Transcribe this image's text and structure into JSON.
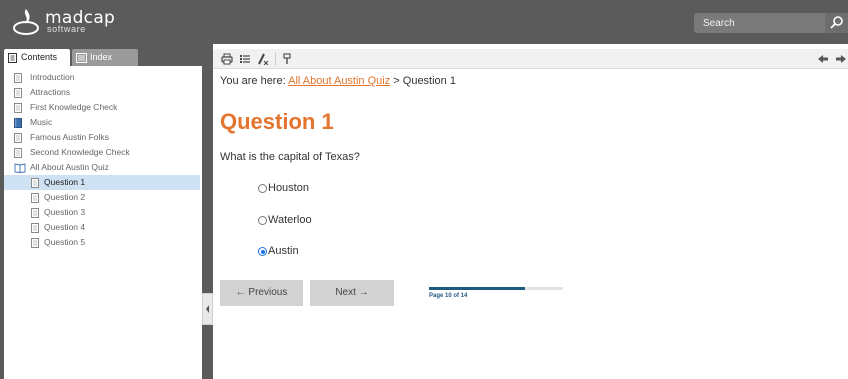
{
  "header": {
    "logo_word": "madcap",
    "logo_sub": "software",
    "search_placeholder": "Search",
    "icons": {
      "logo": "madcap-flame-logo-icon",
      "search": "magnifier-icon"
    }
  },
  "nav": {
    "tabs": [
      {
        "label": "Contents",
        "active": true,
        "icon": "contents-book-icon"
      },
      {
        "label": "Index",
        "active": false,
        "icon": "index-list-icon"
      }
    ],
    "items": [
      {
        "label": "Introduction",
        "level": 0,
        "icon": "page-icon",
        "selected": false
      },
      {
        "label": "Attractions",
        "level": 0,
        "icon": "page-icon",
        "selected": false
      },
      {
        "label": "First Knowledge Check",
        "level": 0,
        "icon": "page-icon",
        "selected": false
      },
      {
        "label": "Music",
        "level": 0,
        "icon": "closed-book-icon",
        "selected": false
      },
      {
        "label": "Famous Austin Folks",
        "level": 0,
        "icon": "page-icon",
        "selected": false
      },
      {
        "label": "Second Knowledge Check",
        "level": 0,
        "icon": "page-icon",
        "selected": false
      },
      {
        "label": "All About Austin Quiz",
        "level": 0,
        "icon": "open-book-icon",
        "selected": false
      },
      {
        "label": "Question 1",
        "level": 1,
        "icon": "page-icon",
        "selected": true
      },
      {
        "label": "Question 2",
        "level": 1,
        "icon": "page-icon",
        "selected": false
      },
      {
        "label": "Question 3",
        "level": 1,
        "icon": "page-icon",
        "selected": false
      },
      {
        "label": "Question 4",
        "level": 1,
        "icon": "page-icon",
        "selected": false
      },
      {
        "label": "Question 5",
        "level": 1,
        "icon": "page-icon",
        "selected": false
      }
    ]
  },
  "toolbar": {
    "buttons": [
      "print-icon",
      "list-icon",
      "clear-highlight-icon",
      "remove-highlight-icon",
      "back-arrow-icon",
      "forward-arrow-icon"
    ]
  },
  "main": {
    "breadcrumb_prefix": "You are here: ",
    "breadcrumb_link": "All About Austin Quiz",
    "breadcrumb_current": " > Question 1",
    "title": "Question 1",
    "question": "What is the capital of Texas?",
    "options": [
      {
        "label": "Houston",
        "checked": false
      },
      {
        "label": "Waterloo",
        "checked": false
      },
      {
        "label": "Austin",
        "checked": true
      }
    ],
    "prev_label": "← Previous",
    "next_label": "Next →",
    "progress_fraction": 0.714,
    "page_count": "Page 10 of 14"
  },
  "colors": {
    "header_bg": "#5b5b5b",
    "accent": "#e4742e",
    "selected_row": "#cfe2f3",
    "progress": "#1e5a80"
  }
}
